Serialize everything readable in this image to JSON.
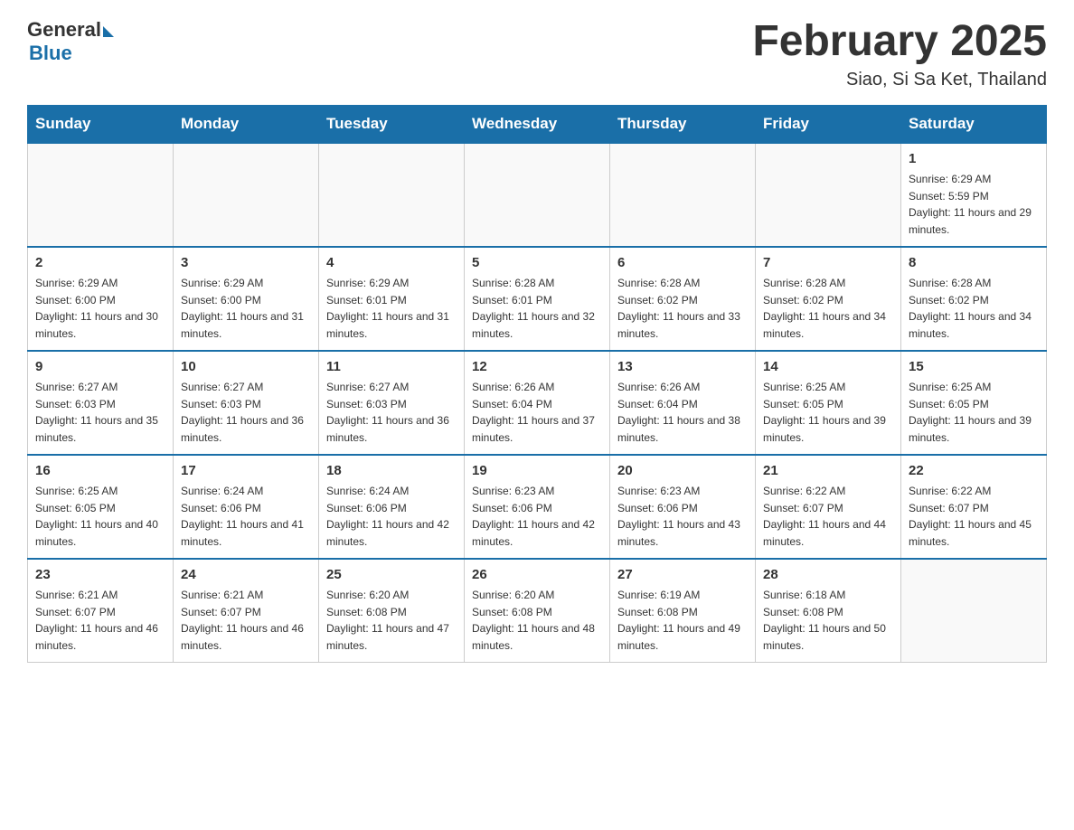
{
  "logo": {
    "general": "General",
    "blue": "Blue"
  },
  "header": {
    "title": "February 2025",
    "location": "Siao, Si Sa Ket, Thailand"
  },
  "weekdays": [
    "Sunday",
    "Monday",
    "Tuesday",
    "Wednesday",
    "Thursday",
    "Friday",
    "Saturday"
  ],
  "weeks": [
    [
      {
        "day": "",
        "info": ""
      },
      {
        "day": "",
        "info": ""
      },
      {
        "day": "",
        "info": ""
      },
      {
        "day": "",
        "info": ""
      },
      {
        "day": "",
        "info": ""
      },
      {
        "day": "",
        "info": ""
      },
      {
        "day": "1",
        "info": "Sunrise: 6:29 AM\nSunset: 5:59 PM\nDaylight: 11 hours and 29 minutes."
      }
    ],
    [
      {
        "day": "2",
        "info": "Sunrise: 6:29 AM\nSunset: 6:00 PM\nDaylight: 11 hours and 30 minutes."
      },
      {
        "day": "3",
        "info": "Sunrise: 6:29 AM\nSunset: 6:00 PM\nDaylight: 11 hours and 31 minutes."
      },
      {
        "day": "4",
        "info": "Sunrise: 6:29 AM\nSunset: 6:01 PM\nDaylight: 11 hours and 31 minutes."
      },
      {
        "day": "5",
        "info": "Sunrise: 6:28 AM\nSunset: 6:01 PM\nDaylight: 11 hours and 32 minutes."
      },
      {
        "day": "6",
        "info": "Sunrise: 6:28 AM\nSunset: 6:02 PM\nDaylight: 11 hours and 33 minutes."
      },
      {
        "day": "7",
        "info": "Sunrise: 6:28 AM\nSunset: 6:02 PM\nDaylight: 11 hours and 34 minutes."
      },
      {
        "day": "8",
        "info": "Sunrise: 6:28 AM\nSunset: 6:02 PM\nDaylight: 11 hours and 34 minutes."
      }
    ],
    [
      {
        "day": "9",
        "info": "Sunrise: 6:27 AM\nSunset: 6:03 PM\nDaylight: 11 hours and 35 minutes."
      },
      {
        "day": "10",
        "info": "Sunrise: 6:27 AM\nSunset: 6:03 PM\nDaylight: 11 hours and 36 minutes."
      },
      {
        "day": "11",
        "info": "Sunrise: 6:27 AM\nSunset: 6:03 PM\nDaylight: 11 hours and 36 minutes."
      },
      {
        "day": "12",
        "info": "Sunrise: 6:26 AM\nSunset: 6:04 PM\nDaylight: 11 hours and 37 minutes."
      },
      {
        "day": "13",
        "info": "Sunrise: 6:26 AM\nSunset: 6:04 PM\nDaylight: 11 hours and 38 minutes."
      },
      {
        "day": "14",
        "info": "Sunrise: 6:25 AM\nSunset: 6:05 PM\nDaylight: 11 hours and 39 minutes."
      },
      {
        "day": "15",
        "info": "Sunrise: 6:25 AM\nSunset: 6:05 PM\nDaylight: 11 hours and 39 minutes."
      }
    ],
    [
      {
        "day": "16",
        "info": "Sunrise: 6:25 AM\nSunset: 6:05 PM\nDaylight: 11 hours and 40 minutes."
      },
      {
        "day": "17",
        "info": "Sunrise: 6:24 AM\nSunset: 6:06 PM\nDaylight: 11 hours and 41 minutes."
      },
      {
        "day": "18",
        "info": "Sunrise: 6:24 AM\nSunset: 6:06 PM\nDaylight: 11 hours and 42 minutes."
      },
      {
        "day": "19",
        "info": "Sunrise: 6:23 AM\nSunset: 6:06 PM\nDaylight: 11 hours and 42 minutes."
      },
      {
        "day": "20",
        "info": "Sunrise: 6:23 AM\nSunset: 6:06 PM\nDaylight: 11 hours and 43 minutes."
      },
      {
        "day": "21",
        "info": "Sunrise: 6:22 AM\nSunset: 6:07 PM\nDaylight: 11 hours and 44 minutes."
      },
      {
        "day": "22",
        "info": "Sunrise: 6:22 AM\nSunset: 6:07 PM\nDaylight: 11 hours and 45 minutes."
      }
    ],
    [
      {
        "day": "23",
        "info": "Sunrise: 6:21 AM\nSunset: 6:07 PM\nDaylight: 11 hours and 46 minutes."
      },
      {
        "day": "24",
        "info": "Sunrise: 6:21 AM\nSunset: 6:07 PM\nDaylight: 11 hours and 46 minutes."
      },
      {
        "day": "25",
        "info": "Sunrise: 6:20 AM\nSunset: 6:08 PM\nDaylight: 11 hours and 47 minutes."
      },
      {
        "day": "26",
        "info": "Sunrise: 6:20 AM\nSunset: 6:08 PM\nDaylight: 11 hours and 48 minutes."
      },
      {
        "day": "27",
        "info": "Sunrise: 6:19 AM\nSunset: 6:08 PM\nDaylight: 11 hours and 49 minutes."
      },
      {
        "day": "28",
        "info": "Sunrise: 6:18 AM\nSunset: 6:08 PM\nDaylight: 11 hours and 50 minutes."
      },
      {
        "day": "",
        "info": ""
      }
    ]
  ]
}
